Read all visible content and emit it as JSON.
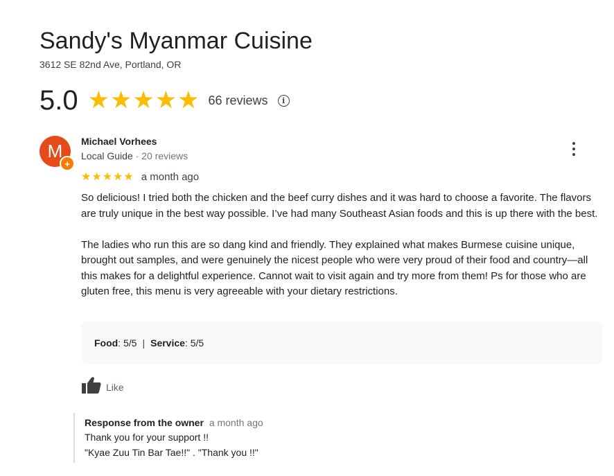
{
  "business": {
    "name": "Sandy's Myanmar Cuisine",
    "address": "3612 SE 82nd Ave, Portland, OR",
    "rating": "5.0",
    "rating_value": 5,
    "stars": "★★★★★",
    "reviews_label": "66 reviews",
    "info_icon": "i"
  },
  "review": {
    "avatar_letter": "M",
    "avatar_color": "#e64a19",
    "badge_glyph": "+",
    "reviewer_name": "Michael Vorhees",
    "reviewer_role": "Local Guide",
    "meta_separator": " · ",
    "reviewer_review_count": "20 reviews",
    "star_rating": 5,
    "stars": "★★★★★",
    "date": "a month ago",
    "paragraphs": [
      "So delicious! I tried both the chicken and the beef curry dishes and it was hard to choose a favorite. The flavors are truly unique in the best way possible. I’ve had many Southeast Asian foods and this is up there with the best.",
      "The ladies who run this are so dang kind and friendly. They explained what makes Burmese cuisine unique, brought out samples, and were genuinely the nicest people who were very proud of their food and country—all this makes for a delightful experience. Cannot wait to visit again and try more from them!  Ps for those who are gluten free, this menu is very agreeable with your dietary restrictions."
    ],
    "aspects": [
      {
        "label": "Food",
        "value": ": 5/5"
      },
      {
        "label": "Service",
        "value": ": 5/5"
      }
    ],
    "aspect_separator": "|",
    "like_label": "Like"
  },
  "owner_response": {
    "heading": "Response from the owner",
    "date": "a month ago",
    "lines": [
      "Thank you for your support !!",
      "\"Kyae Zuu Tin Bar Tae!!\" . \"Thank you !!\""
    ]
  },
  "colors": {
    "star": "#fbbc04",
    "badge": "#f57c00",
    "panel": "#f8f9fa"
  },
  "icons": [
    "info-icon",
    "more-vert-icon",
    "thumbs-up-icon",
    "local-guide-badge-icon"
  ]
}
